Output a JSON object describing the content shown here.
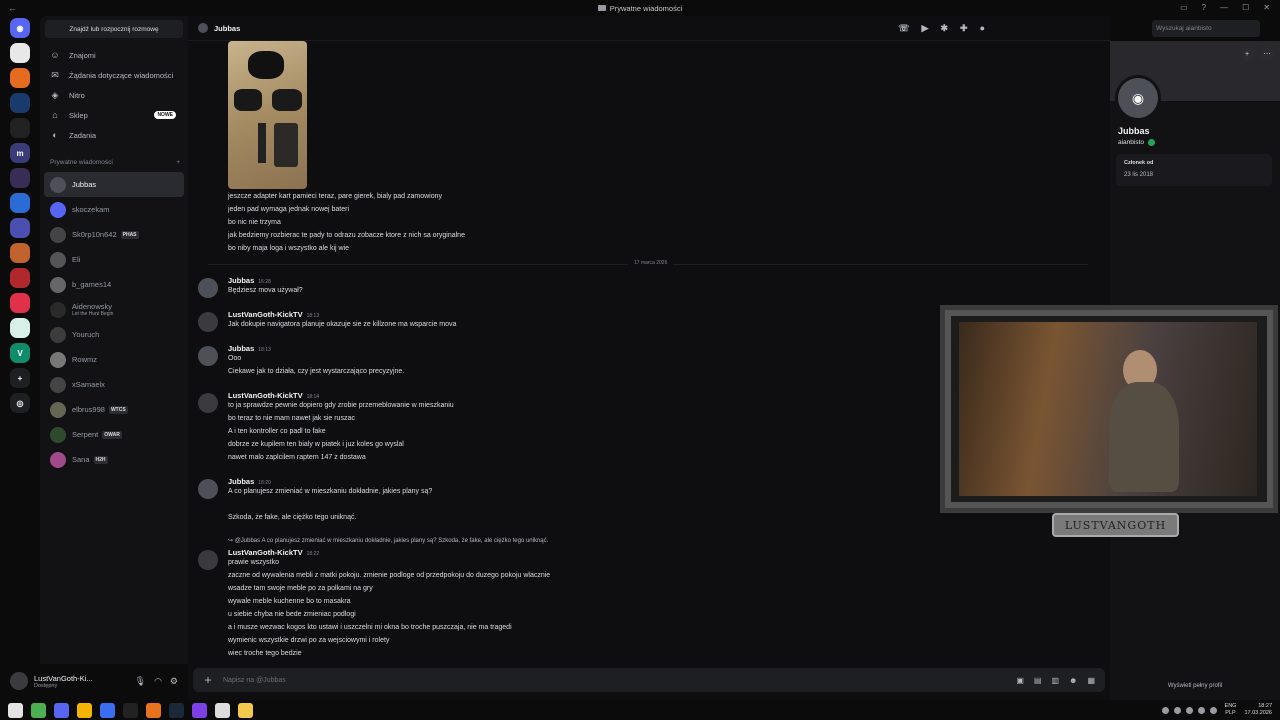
{
  "window": {
    "title": "Prywatne wiadomości"
  },
  "servers": [
    {
      "name": "discord-home",
      "color": "#5865f2",
      "glyph": "◉"
    },
    {
      "name": "server-1",
      "color": "#e8e8e8",
      "glyph": ""
    },
    {
      "name": "server-2",
      "color": "#e56b1f",
      "glyph": ""
    },
    {
      "name": "server-3",
      "color": "#1a3a6b",
      "glyph": ""
    },
    {
      "name": "server-4",
      "color": "#222",
      "glyph": ""
    },
    {
      "name": "server-5",
      "color": "#3b3b7a",
      "glyph": "m"
    },
    {
      "name": "server-6",
      "color": "#3a2d55",
      "glyph": ""
    },
    {
      "name": "server-7",
      "color": "#2b6bd6",
      "glyph": ""
    },
    {
      "name": "server-8",
      "color": "#4b4fb0",
      "glyph": ""
    },
    {
      "name": "server-9",
      "color": "#c0632c",
      "glyph": ""
    },
    {
      "name": "server-10",
      "color": "#b0282c",
      "glyph": ""
    },
    {
      "name": "server-11",
      "color": "#e0314b",
      "glyph": ""
    },
    {
      "name": "server-12",
      "color": "#d8f2ea",
      "glyph": ""
    },
    {
      "name": "server-13",
      "color": "#0f8c6a",
      "glyph": "V"
    },
    {
      "name": "add-server",
      "color": "#1e1f22",
      "glyph": "+"
    },
    {
      "name": "discover",
      "color": "#1e1f22",
      "glyph": "◎"
    }
  ],
  "dm_sidebar": {
    "search_label": "Znajdź lub rozpocznij rozmowę",
    "nav": [
      {
        "label": "Znajomi",
        "icon": "friends-icon",
        "glyph": "☺"
      },
      {
        "label": "Żądania dotyczące wiadomości",
        "icon": "message-requests-icon",
        "glyph": "✉"
      },
      {
        "label": "Nitro",
        "icon": "nitro-icon",
        "glyph": "◈"
      },
      {
        "label": "Sklep",
        "icon": "shop-icon",
        "glyph": "⌂",
        "badge": "NOWE"
      },
      {
        "label": "Zadania",
        "icon": "quests-icon",
        "glyph": "◐"
      }
    ],
    "dm_header": "Prywatne wiadomości",
    "dm_add": "+",
    "dms": [
      {
        "name": "Jubbas",
        "color": "#4e5058",
        "active": true
      },
      {
        "name": "skoczekam",
        "color": "#5865f2"
      },
      {
        "name": "Sk0rp10n642",
        "color": "#444",
        "tag": "PHAS"
      },
      {
        "name": "Eli",
        "color": "#555"
      },
      {
        "name": "b_games14",
        "color": "#666"
      },
      {
        "name": "Aidenowsky",
        "sub": "Let the Hunt Begin",
        "color": "#2a2a2a"
      },
      {
        "name": "Youruch",
        "color": "#3c3c3c"
      },
      {
        "name": "Rowmz",
        "color": "#777"
      },
      {
        "name": "xSamaelx",
        "color": "#444"
      },
      {
        "name": "elbrus998",
        "color": "#665",
        "tag": "WTCS"
      },
      {
        "name": "Serpent",
        "color": "#2d4a2d",
        "tag": "OWAR"
      },
      {
        "name": "Sana",
        "color": "#a04a8a",
        "tag": "H2H"
      }
    ]
  },
  "user_panel": {
    "name": "LustVanGoth-Ki...",
    "status": "Dostępny"
  },
  "chat": {
    "header_name": "Jubbas",
    "search_placeholder": "Wyszukaj aianbisto",
    "input_placeholder": "Napisz na @Jubbas",
    "pre_lines": [
      "jeszcze adapter kart pamieci teraz, pare gierek, bialy pad zamowiony",
      "jeden pad wymaga jednak nowej bateri",
      "bo nic nie trzyma",
      "jak bedziemy rozbierac te pady to odrazu zobacze ktore z nich sa oryginalne",
      "bo niby maja loga i wszystko ale kij wie"
    ],
    "date_divider": "17 marca 2026",
    "groups": [
      {
        "author": "Jubbas",
        "time": "16:28",
        "lines": [
          "Będziesz mova używał?"
        ]
      },
      {
        "author": "LustVanGoth-KickTV",
        "time": "18:13",
        "lines": [
          "Jak dokupie navigatora planuje okazuje sie ze killzone ma wsparcie mova"
        ]
      },
      {
        "author": "Jubbas",
        "time": "18:13",
        "lines": [
          "Ooo",
          "Ciekawe jak to działa, czy jest wystarczająco precyzyjne."
        ]
      },
      {
        "author": "LustVanGoth-KickTV",
        "time": "18:14",
        "lines": [
          "to ja sprawdze pewnie dopiero gdy zrobie przemeblowanie w mieszkaniu",
          "bo teraz to nie mam nawet jak sie ruszac",
          "A i ten kontroller co padl to fake",
          "dobrze ze kupilem ten bialy w piatek i juz koles go wyslal",
          "nawet malo zaplcilem raptem 147 z dostawa"
        ]
      },
      {
        "author": "Jubbas",
        "time": "18:20",
        "lines": [
          "A co planujesz zmieniać w mieszkaniu dokładnie, jakies plany są?",
          "",
          "Szkoda, że fake, ale ciężko tego uniknąć."
        ]
      },
      {
        "reply": "@Jubbas A co planujesz zmieniać w mieszkaniu dokładnie, jakies plany są? Szkoda, że fake, ale ciężko tego uniknąć.",
        "author": "LustVanGoth-KickTV",
        "time": "18:22",
        "lines": [
          "prawie wszystko",
          "zaczne od wywalenia mebli z matki pokoju. zmienie podloge od przedpokoju do duzego pokoju wlacznie",
          "wsadze tam swoje meble po za polkami na gry",
          "wywale meble kuchenne bo to masakra",
          "u siebie chyba nie bede zmieniac podlogi",
          "a i musze wezwac kogos kto ustawi i uszczelni mi okna bo troche puszczaja, nie ma tragedi",
          "wymienic wszystkie drzwi po za wejsciowymi i rolety",
          "wiec troche tego bedzie"
        ]
      }
    ]
  },
  "profile": {
    "name": "Jubbas",
    "username": "aianbisto",
    "member_header": "Członek od",
    "member_date": "23 lis 2018",
    "full_profile": "Wyświetl pełny profil"
  },
  "overlay": {
    "nameplate": "LUSTVANGOTH"
  },
  "taskbar": {
    "lang_top": "ENG",
    "lang_bottom": "PLP",
    "time": "18:27",
    "date": "17.03.2026",
    "apps": [
      "#e3e3e3",
      "#4caf50",
      "#5865f2",
      "#f4b400",
      "#3a6df0",
      "#222",
      "#e8731c",
      "#1b2838",
      "#7b3fe4",
      "#ddd",
      "#f2c94c"
    ]
  }
}
